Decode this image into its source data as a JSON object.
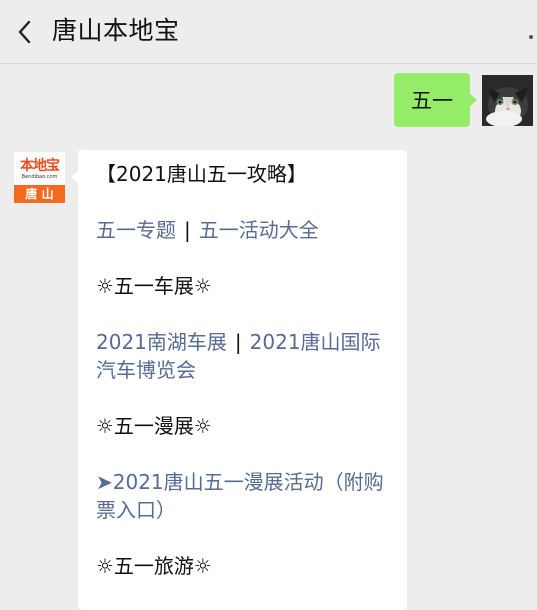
{
  "header": {
    "title": "唐山本地宝"
  },
  "outgoing": {
    "text": "五一"
  },
  "bot_avatar": {
    "logo_text": "本地宝",
    "logo_domain": "Bendibao.com",
    "city": "唐 山"
  },
  "message": {
    "heading": "【2021唐山五一攻略】",
    "links_row_1": {
      "a": "五一专题",
      "sep": "|",
      "b": "五一活动大全"
    },
    "section_car": "☼五一车展☼",
    "links_row_2": {
      "a": "2021南湖车展",
      "sep": "|",
      "b_line1": "2021唐山国际",
      "b_line2": "汽车博览会"
    },
    "section_comic": "☼五一漫展☼",
    "comic_link_line1": "➤2021唐山五一漫展活动（附购",
    "comic_link_line2": "票入口）",
    "section_travel": "☼五一旅游☼"
  },
  "icons": {
    "back": "chevron-left-icon",
    "more": "more-dots-icon"
  },
  "colors": {
    "background": "#ededed",
    "outgoing_bubble": "#95ec69",
    "link": "#576b95",
    "logo_orange": "#f26a20"
  }
}
